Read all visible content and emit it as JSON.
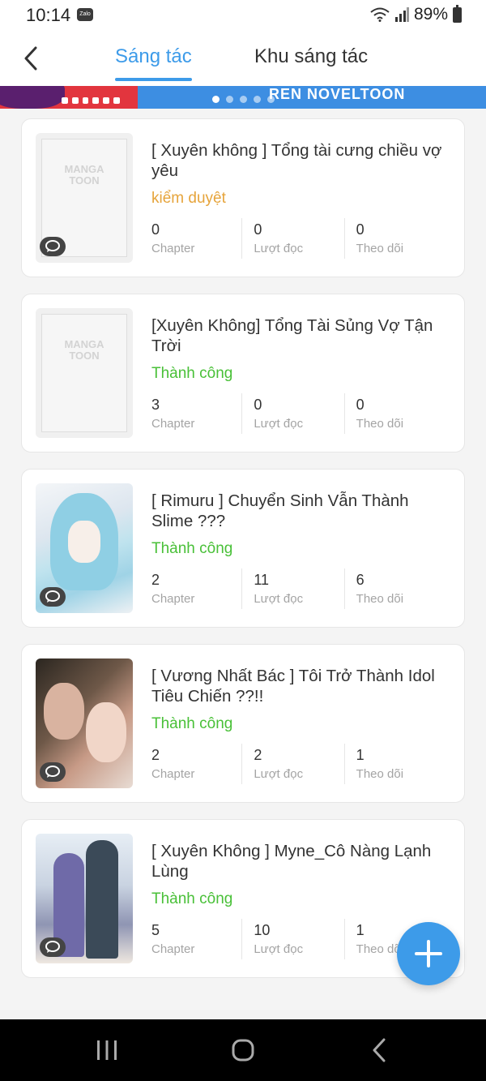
{
  "status_bar": {
    "time": "10:14",
    "zalo": "Zalo",
    "battery": "89%"
  },
  "header": {
    "tabs": [
      {
        "label": "Sáng tác"
      },
      {
        "label": "Khu sáng tác"
      }
    ]
  },
  "banner": {
    "text": "REN NOVELTOON"
  },
  "works": [
    {
      "title": "[ Xuyên không ] Tổng tài cưng chiều vợ yêu",
      "status": "kiểm duyệt",
      "stats": [
        {
          "value": "0",
          "label": "Chapter"
        },
        {
          "value": "0",
          "label": "Lượt đọc"
        },
        {
          "value": "0",
          "label": "Theo dõi"
        }
      ]
    },
    {
      "title": "[Xuyên Không] Tổng Tài Sủng Vợ Tận Trời",
      "status": "Thành công",
      "stats": [
        {
          "value": "3",
          "label": "Chapter"
        },
        {
          "value": "0",
          "label": "Lượt đọc"
        },
        {
          "value": "0",
          "label": "Theo dõi"
        }
      ]
    },
    {
      "title": "[ Rimuru ] Chuyển Sinh Vẫn Thành Slime ???",
      "status": "Thành công",
      "stats": [
        {
          "value": "2",
          "label": "Chapter"
        },
        {
          "value": "11",
          "label": "Lượt đọc"
        },
        {
          "value": "6",
          "label": "Theo dõi"
        }
      ]
    },
    {
      "title": "[ Vương Nhất Bác ] Tôi Trở Thành Idol Tiêu Chiến ??!!",
      "status": "Thành công",
      "stats": [
        {
          "value": "2",
          "label": "Chapter"
        },
        {
          "value": "2",
          "label": "Lượt đọc"
        },
        {
          "value": "1",
          "label": "Theo dõi"
        }
      ]
    },
    {
      "title": "[ Xuyên Không ] Myne_Cô Nàng Lạnh Lùng",
      "status": "Thành công",
      "stats": [
        {
          "value": "5",
          "label": "Chapter"
        },
        {
          "value": "10",
          "label": "Lượt đọc"
        },
        {
          "value": "1",
          "label": "Theo dõi"
        }
      ]
    }
  ],
  "placeholder_cover": {
    "logo_line1": "MANGA",
    "logo_line2": "TOON"
  },
  "colors": {
    "accent": "#3d9be9",
    "status_review": "#e6a43b",
    "status_success": "#49c038"
  }
}
